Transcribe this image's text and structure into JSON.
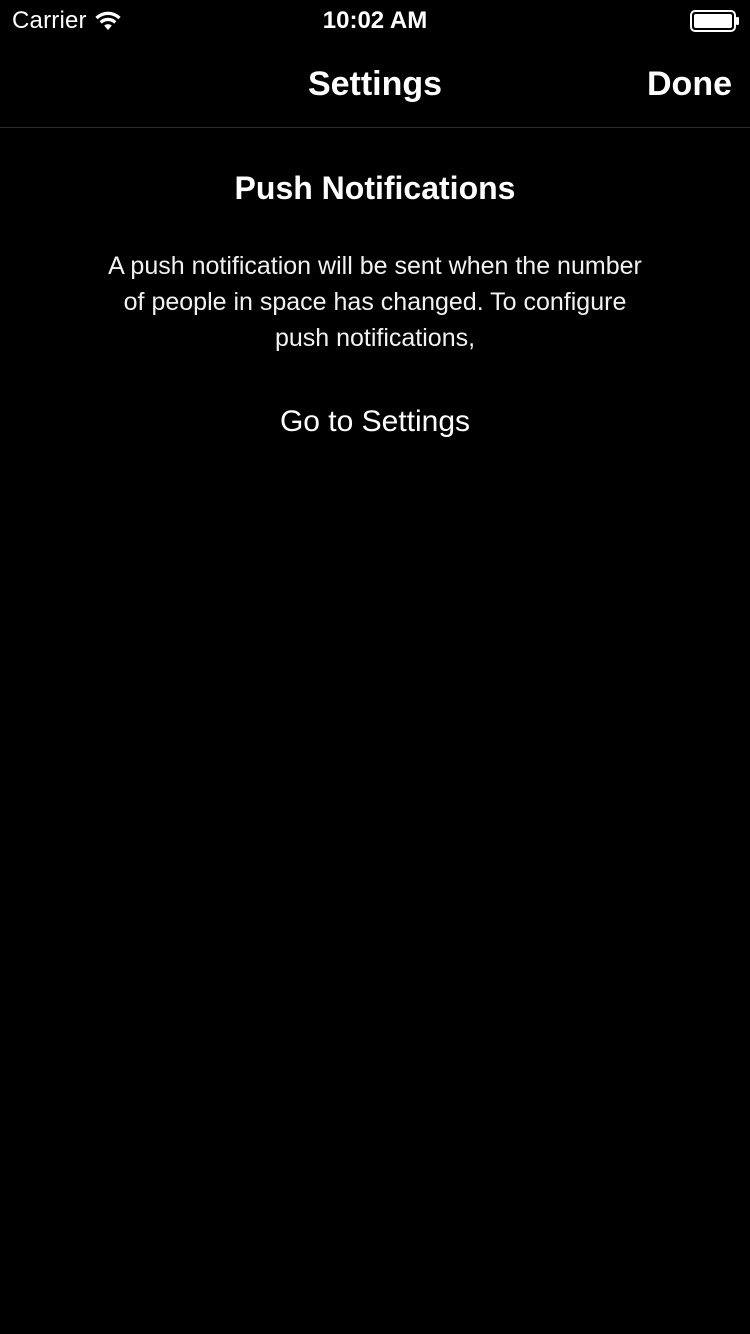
{
  "status_bar": {
    "carrier": "Carrier",
    "time": "10:02 AM",
    "wifi_icon": "wifi-icon",
    "battery_icon": "battery-full-icon"
  },
  "nav": {
    "title": "Settings",
    "done_label": "Done"
  },
  "content": {
    "section_title": "Push Notifications",
    "description": "A push notification will be sent when the number of people in space has changed. To configure push notifications,",
    "settings_link": "Go to Settings"
  },
  "colors": {
    "background": "#000000",
    "text": "#ffffff"
  }
}
